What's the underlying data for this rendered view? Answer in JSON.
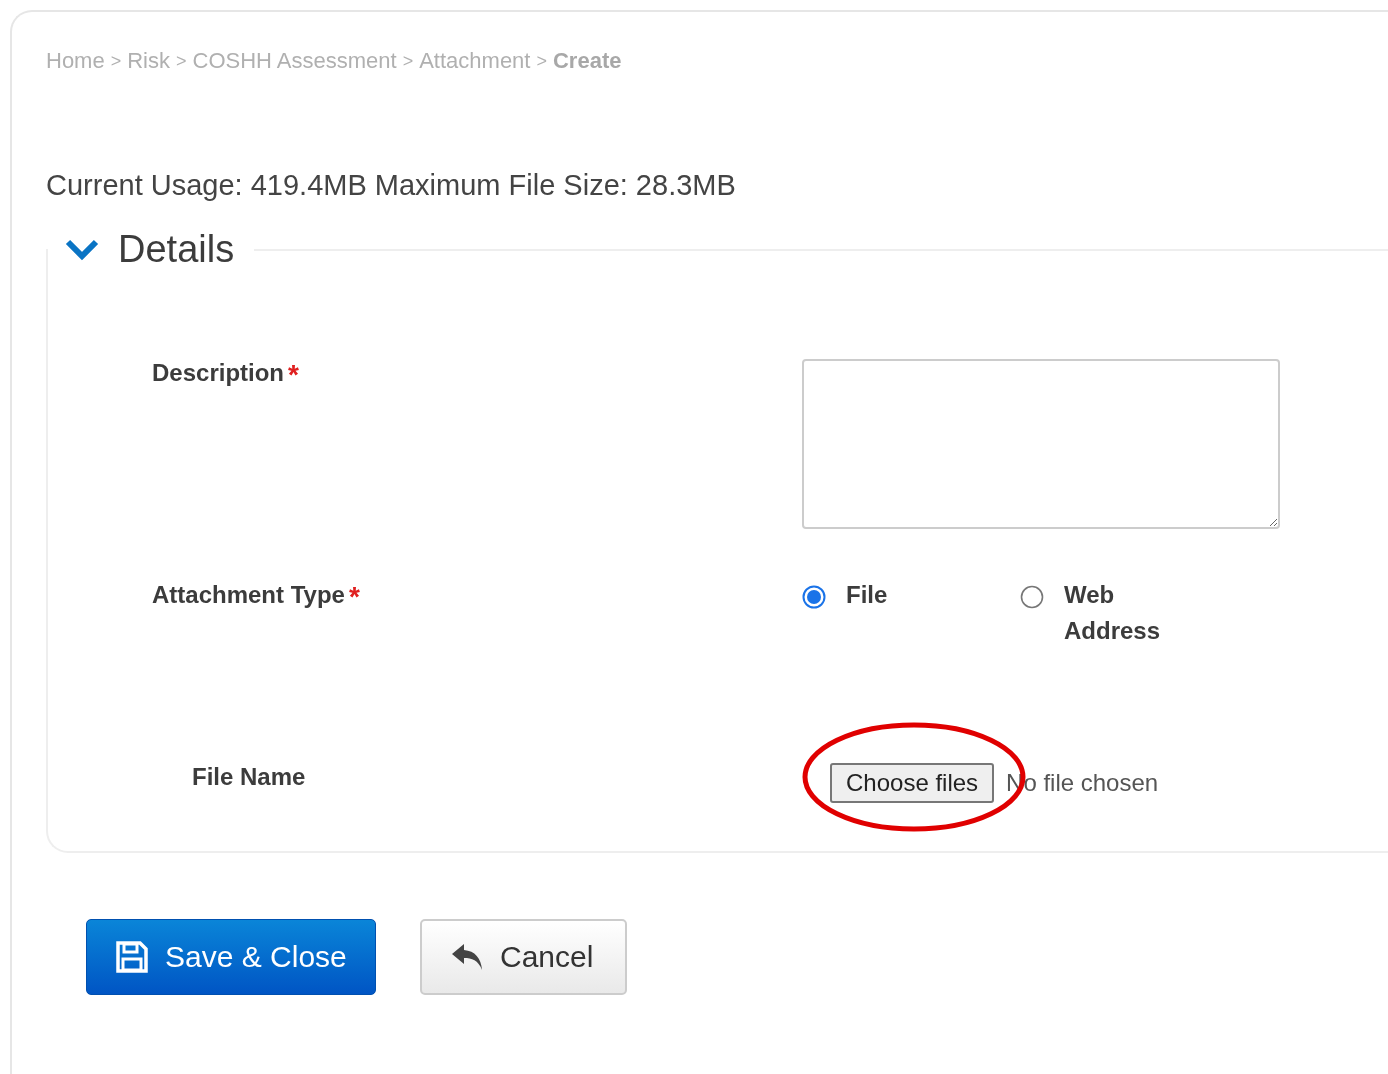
{
  "breadcrumb": {
    "separator": ">",
    "items": [
      {
        "label": "Home"
      },
      {
        "label": "Risk"
      },
      {
        "label": "COSHH Assessment"
      },
      {
        "label": "Attachment"
      },
      {
        "label": "Create",
        "current": true
      }
    ]
  },
  "usage": "Current Usage: 419.4MB Maximum File Size: 28.3MB",
  "details": {
    "title": "Details",
    "expanded": true,
    "fields": [
      {
        "kind": "textarea",
        "label": "Description",
        "required_mark": "*"
      },
      {
        "kind": "radio",
        "label": "Attachment Type",
        "required_mark": "*",
        "options": [
          {
            "label": "File",
            "selected": true
          },
          {
            "label": "Web Address",
            "selected": false
          }
        ]
      },
      {
        "kind": "file",
        "label": "File Name",
        "button": "Choose files",
        "status": "No file chosen",
        "annotation": {
          "kind": "ellipse",
          "color": "#e00000"
        }
      }
    ]
  },
  "buttons": [
    {
      "kind": "primary",
      "label": "Save & Close"
    },
    {
      "kind": "secondary",
      "label": "Cancel"
    }
  ]
}
